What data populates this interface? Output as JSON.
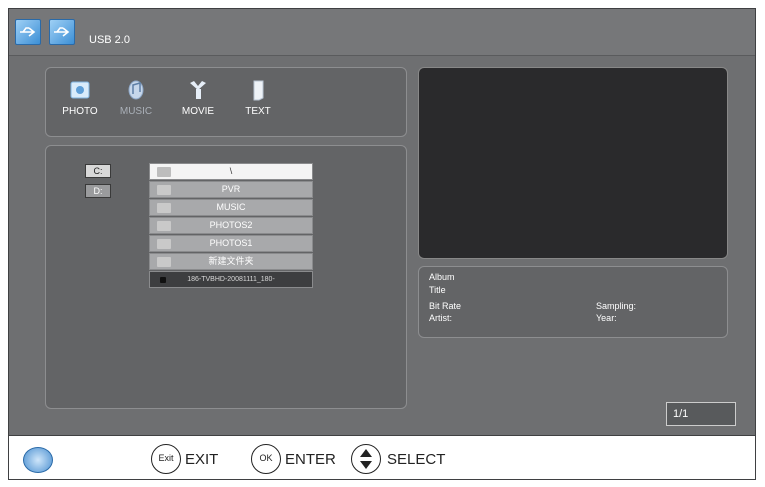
{
  "header": {
    "device_label": "USB 2.0"
  },
  "media_tabs": [
    {
      "label": "PHOTO",
      "icon": "photo-icon"
    },
    {
      "label": "MUSIC",
      "icon": "music-icon"
    },
    {
      "label": "MOVIE",
      "icon": "movie-icon"
    },
    {
      "label": "TEXT",
      "icon": "text-icon"
    }
  ],
  "drives": [
    "C:",
    "D:"
  ],
  "files": [
    {
      "name": "\\",
      "selected": true
    },
    {
      "name": "PVR"
    },
    {
      "name": "MUSIC"
    },
    {
      "name": "PHOTOS2"
    },
    {
      "name": "PHOTOS1"
    },
    {
      "name": "新建文件夹"
    },
    {
      "name": "186-TVBHD-20081111_180-"
    }
  ],
  "info": {
    "album_label": "Album",
    "title_label": "Title",
    "bitrate_label": "Bit Rate",
    "sampling_label": "Sampling:",
    "artist_label": "Artist:",
    "year_label": "Year:"
  },
  "pager": "1/1",
  "footer": {
    "exit_key": "Exit",
    "exit_label": "EXIT",
    "ok_key": "OK",
    "enter_label": "ENTER",
    "select_label": "SELECT"
  },
  "colors": {
    "background": "#6e6f71",
    "panel": "#636466",
    "preview": "#2a2a2c"
  }
}
